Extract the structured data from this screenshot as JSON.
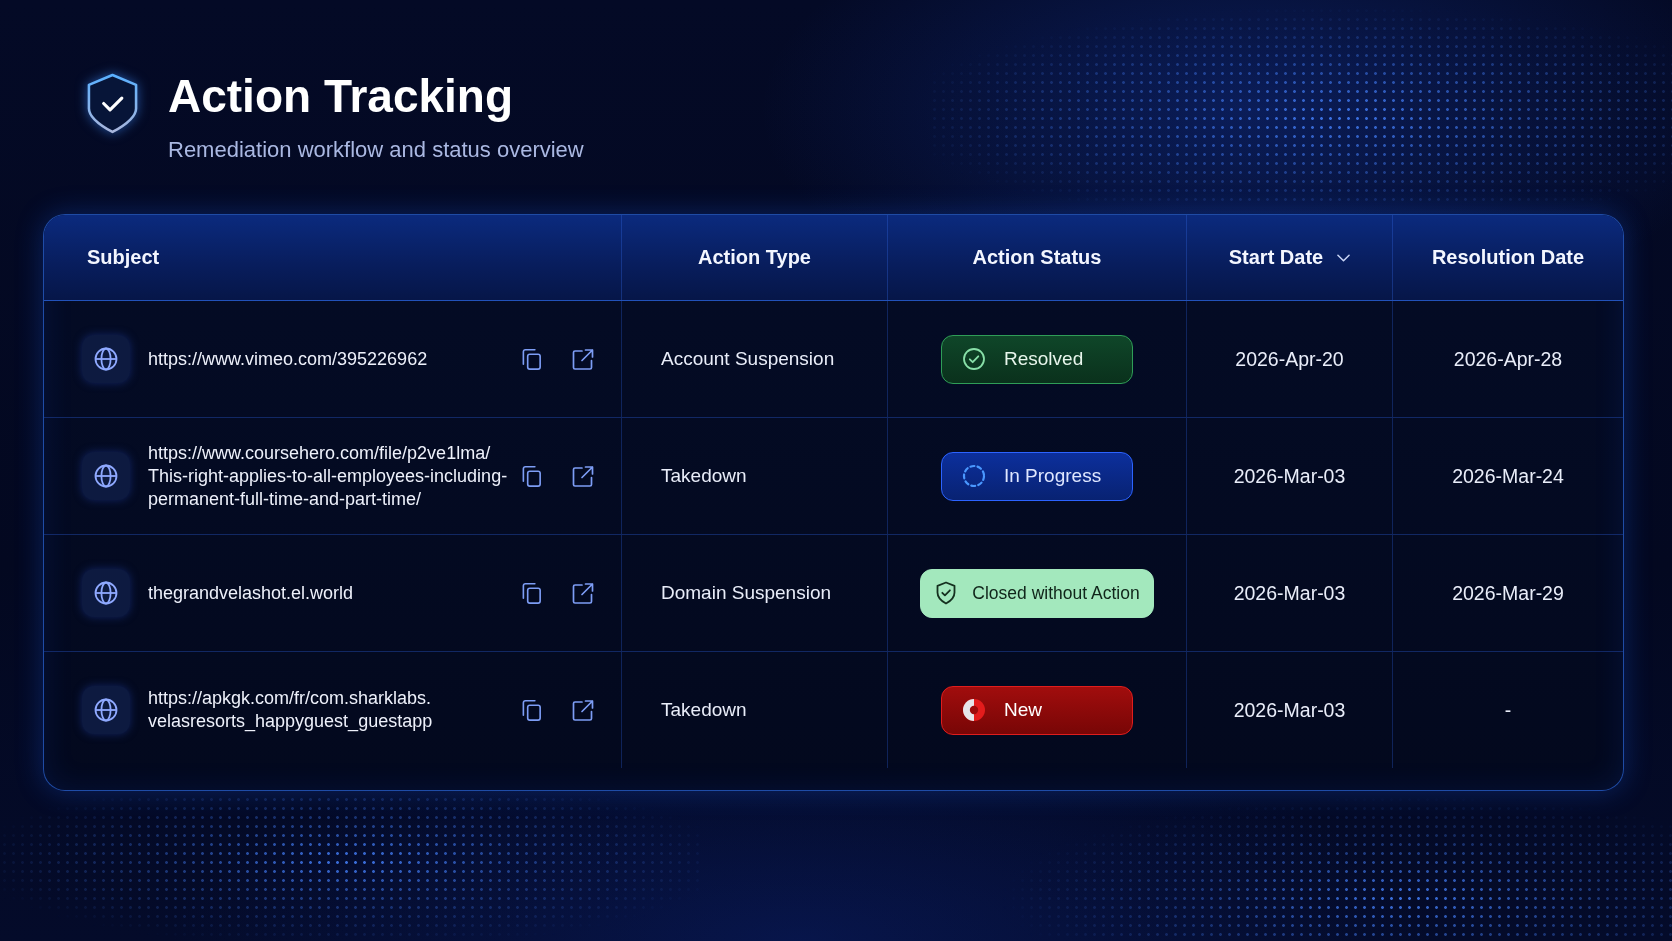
{
  "header": {
    "title": "Action Tracking",
    "subtitle": "Remediation workflow and status overview"
  },
  "table": {
    "columns": [
      {
        "label": "Subject",
        "sorted": false
      },
      {
        "label": "Action Type",
        "sorted": false
      },
      {
        "label": "Action Status",
        "sorted": false
      },
      {
        "label": "Start Date",
        "sorted": true
      },
      {
        "label": "Resolution Date",
        "sorted": false
      }
    ],
    "rows": [
      {
        "subject": [
          "https://www.vimeo.com/395226962"
        ],
        "action_type": "Account Suspension",
        "status": {
          "label": "Resolved",
          "kind": "resolved"
        },
        "start_date": "2026-Apr-20",
        "resolution_date": "2026-Apr-28"
      },
      {
        "subject": [
          "https://www.coursehero.com/file/p2ve1lma/",
          "This-right-applies-to-all-employees-including-",
          "permanent-full-time-and-part-time/"
        ],
        "action_type": "Takedown",
        "status": {
          "label": "In Progress",
          "kind": "in_progress"
        },
        "start_date": "2026-Mar-03",
        "resolution_date": "2026-Mar-24"
      },
      {
        "subject": [
          "thegrandvelashot.el.world"
        ],
        "action_type": "Domain Suspension",
        "status": {
          "label": "Closed without Action",
          "kind": "closed"
        },
        "start_date": "2026-Mar-03",
        "resolution_date": "2026-Mar-29"
      },
      {
        "subject": [
          "https://apkgk.com/fr/com.sharklabs.",
          "velasresorts_happyguest_guestapp"
        ],
        "action_type": "Takedown",
        "status": {
          "label": "New",
          "kind": "new"
        },
        "start_date": "2026-Mar-03",
        "resolution_date": "-"
      }
    ]
  }
}
